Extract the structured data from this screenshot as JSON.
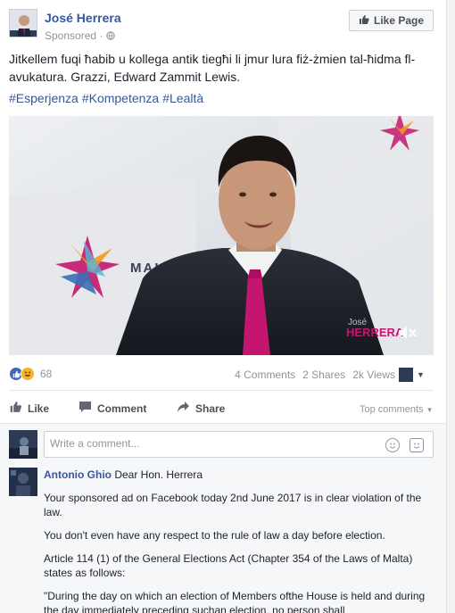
{
  "header": {
    "page_name": "José Herrera",
    "sponsored": "Sponsored",
    "like_page_label": "Like Page"
  },
  "post": {
    "text": "Jitkellem fuqi ħabib u kollega antik tiegħi li jmur lura fiż-żmien tal-ħidma fl-avukatura. Grazzi, Edward Zammit Lewis.",
    "hashtags": [
      "#Esperjenza",
      "#Kompetenza",
      "#Lealtà"
    ]
  },
  "video": {
    "backdrop_text": "MALTA",
    "logo_text_1": "José",
    "logo_text_2": "HERRERA",
    "mute_glyph": "×"
  },
  "stats": {
    "reaction_count": "68",
    "comments": "4 Comments",
    "shares": "2 Shares",
    "views": "2k Views"
  },
  "actions": {
    "like": "Like",
    "comment": "Comment",
    "share": "Share",
    "top_comments": "Top comments"
  },
  "composer": {
    "placeholder": "Write a comment..."
  },
  "comment": {
    "author": "Antonio Ghio",
    "first_line": "Dear Hon. Herrera",
    "paragraphs": [
      "Your sponsored ad on Facebook today 2nd June 2017 is in clear violation of the law.",
      "You don't even have any respect to the rule of law a day before election.",
      "Article 114 (1) of the General Elections Act (Chapter 354 of the Laws of Malta) states as follows:",
      "\"During the day on which an election of Members ofthe House is held and during the day immediately preceding suchan election, no person shall"
    ]
  },
  "colors": {
    "link_blue": "#365899",
    "like_blue": "#4267b2",
    "tie_magenta": "#c5166f"
  }
}
